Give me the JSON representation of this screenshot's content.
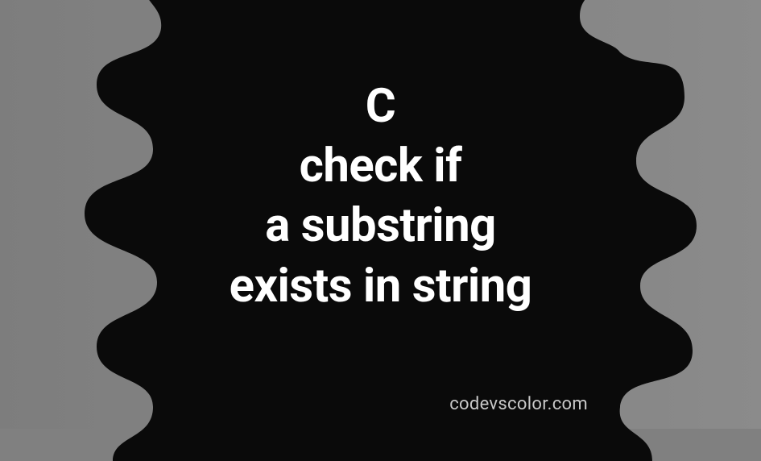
{
  "title": {
    "line1": "C",
    "line2": "check if",
    "line3": "a substring",
    "line4": "exists in string"
  },
  "watermark": "codevscolor.com",
  "colors": {
    "blob": "#0a0a0a",
    "bg_left": "#7d7d7d",
    "bg_right": "#8b8b8b",
    "text": "#ffffff",
    "watermark": "#c9c9c9"
  }
}
